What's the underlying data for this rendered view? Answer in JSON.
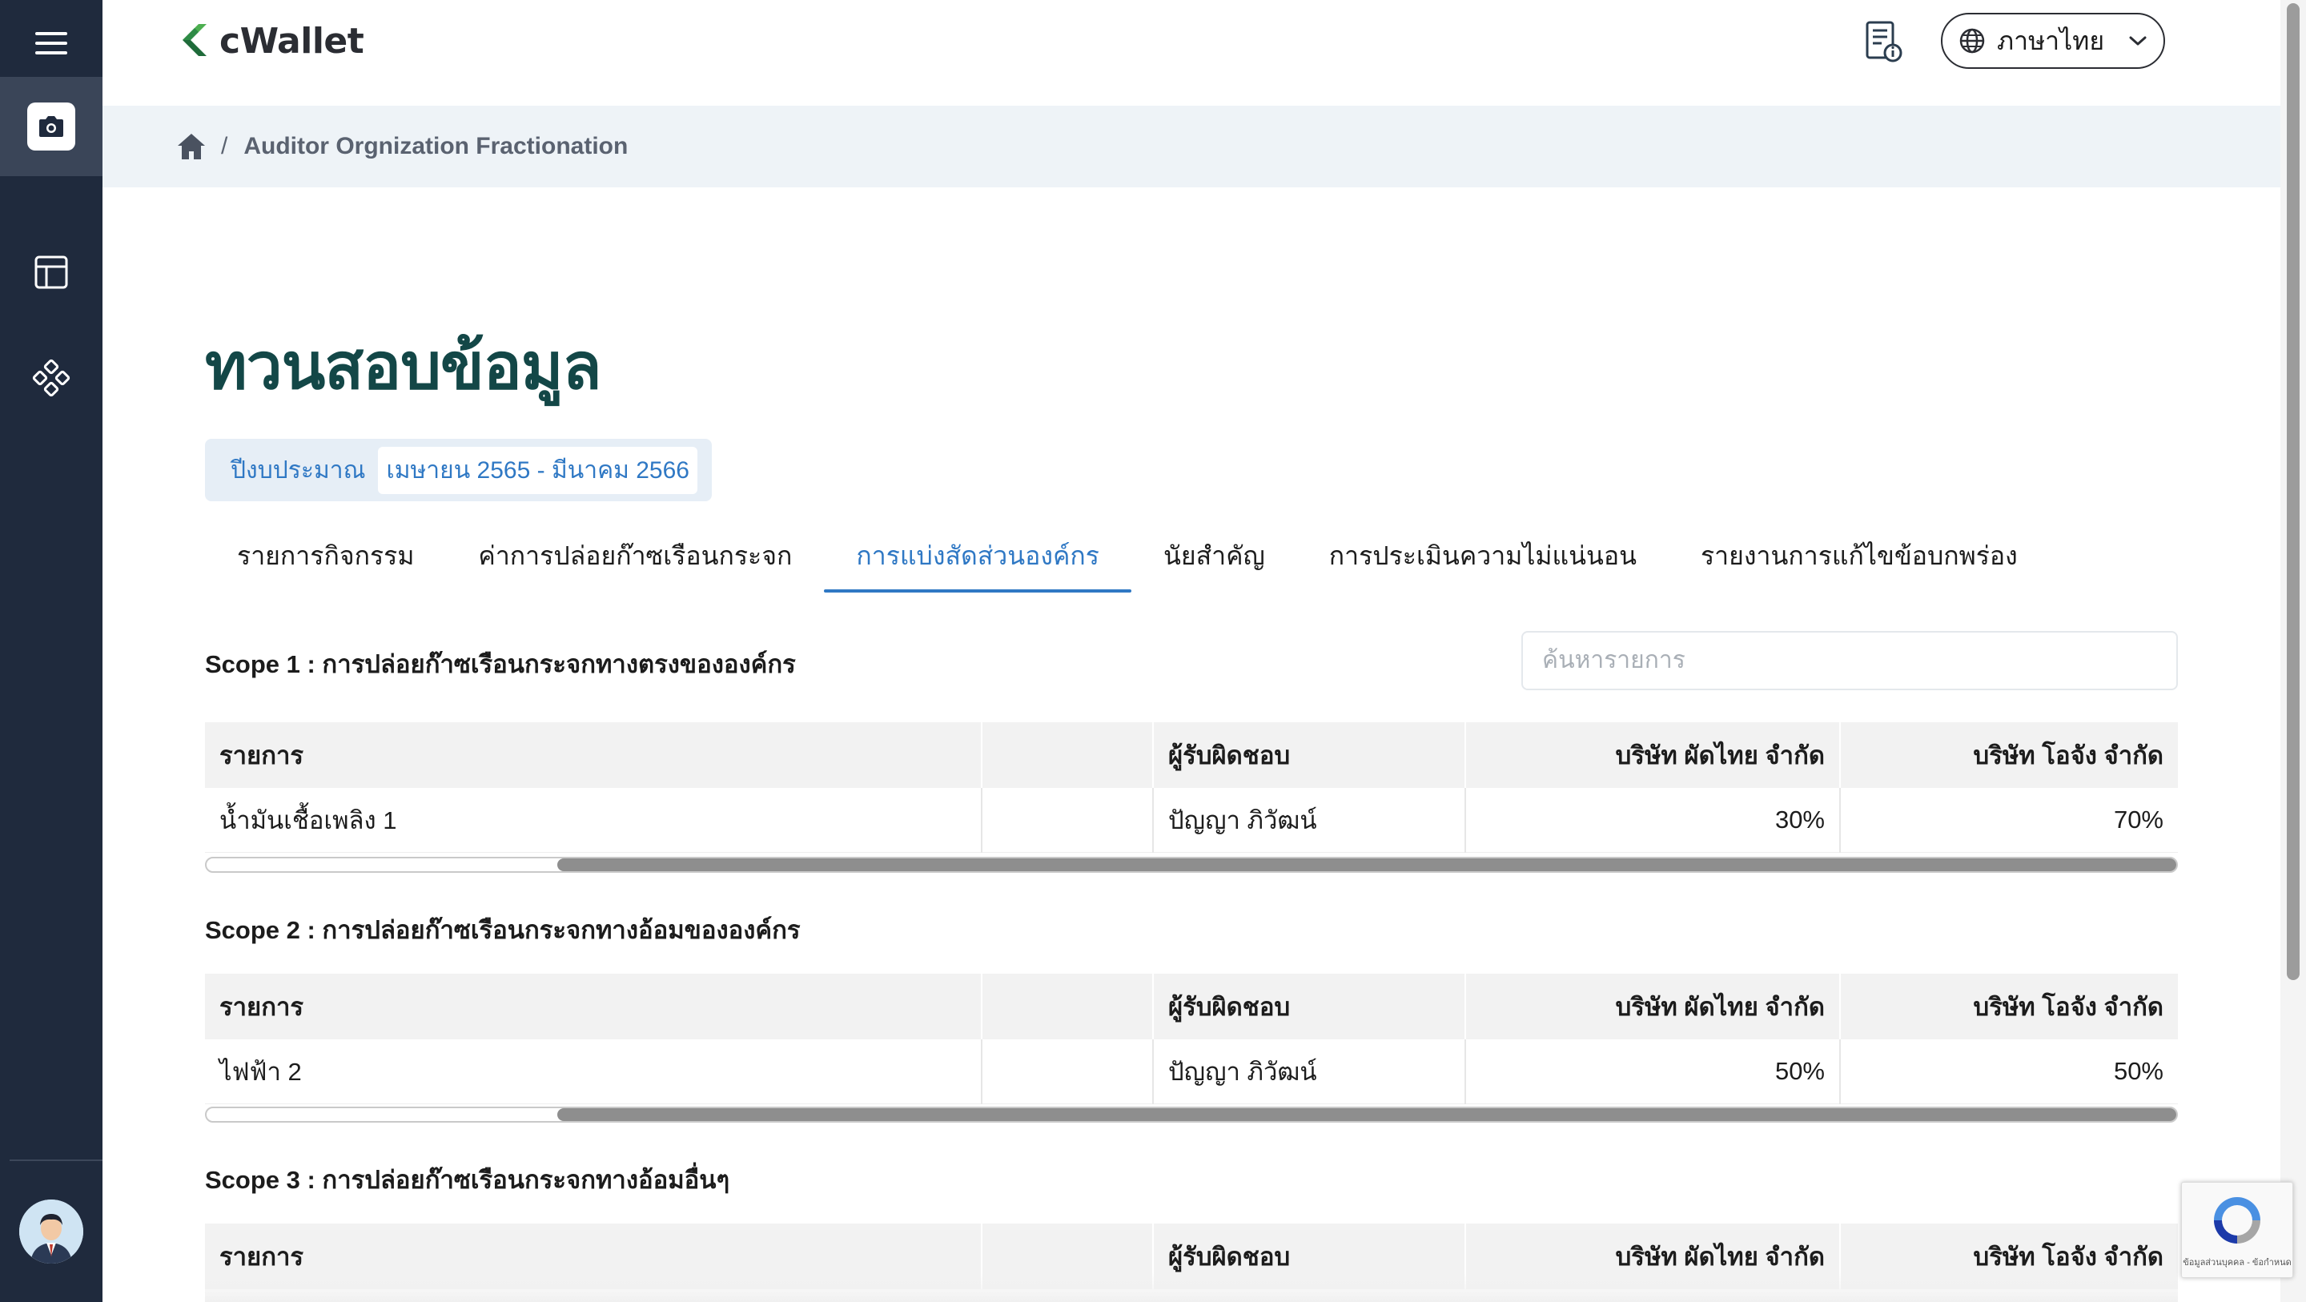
{
  "app": {
    "logo_text": "cWallet",
    "brand_colors": {
      "green_dark": "#1f6b3a",
      "green_light": "#4caf50",
      "accent_blue": "#2f78c4",
      "title_teal": "#134747",
      "sidebar": "#1f2a3d"
    }
  },
  "sidebar": {
    "icons": [
      "menu-icon",
      "camera-icon",
      "layout-icon",
      "nodes-icon",
      "avatar"
    ]
  },
  "header": {
    "language": "ภาษาไทย"
  },
  "breadcrumb": {
    "separator": "/",
    "current": "Auditor Orgnization Fractionation"
  },
  "page": {
    "title": "ทวนสอบข้อมูล",
    "budget_label": "ปีงบประมาณ",
    "budget_value": "เมษายน 2565 - มีนาคม 2566"
  },
  "tabs": [
    {
      "label": "รายการกิจกรรม"
    },
    {
      "label": "ค่าการปล่อยก๊าซเรือนกระจก"
    },
    {
      "label": "การแบ่งสัดส่วนองค์กร"
    },
    {
      "label": "นัยสำคัญ"
    },
    {
      "label": "การประเมินความไม่แน่นอน"
    },
    {
      "label": "รายงานการแก้ไขข้อบกพร่อง"
    }
  ],
  "active_tab": "การแบ่งสัดส่วนองค์กร",
  "search": {
    "placeholder": "ค้นหารายการ"
  },
  "table_headers": {
    "item": "รายการ",
    "blank": "",
    "owner": "ผู้รับผิดชอบ",
    "company1": "บริษัท ผัดไทย จำกัด",
    "company2": "บริษัท โอจัง จำกัด"
  },
  "scopes": [
    {
      "title": "Scope 1 : การปล่อยก๊าซเรือนกระจกทางตรงขององค์กร",
      "rows": [
        {
          "item": "น้ำมันเชื้อเพลิง 1",
          "owner": "ปัญญา   ภิวัฒน์",
          "company1": "30%",
          "company2": "70%"
        }
      ]
    },
    {
      "title": "Scope 2 : การปล่อยก๊าซเรือนกระจกทางอ้อมขององค์กร",
      "rows": [
        {
          "item": "ไฟฟ้า 2",
          "owner": "ปัญญา   ภิวัฒน์",
          "company1": "50%",
          "company2": "50%"
        }
      ]
    },
    {
      "title": "Scope 3 : การปล่อยก๊าซเรือนกระจกทางอ้อมอื่นๆ",
      "rows": []
    }
  ],
  "recaptcha": {
    "text": "ข้อมูลส่วนบุคคล - ข้อกำหนด"
  }
}
